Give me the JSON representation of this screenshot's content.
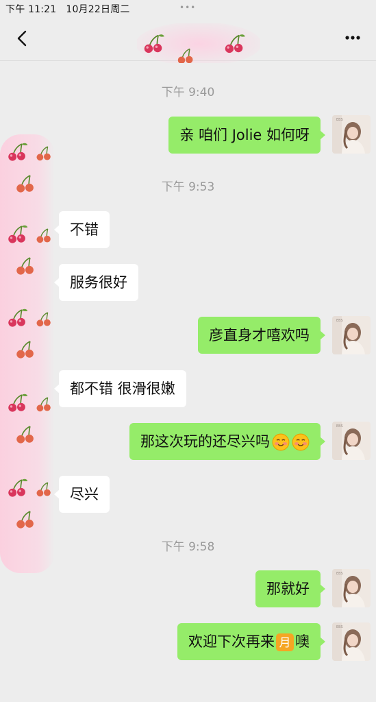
{
  "status": {
    "time": "下午 11:21",
    "date": "10月22日周二",
    "dots": "•••"
  },
  "chat": {
    "timestamps": [
      "下午 9:40",
      "下午 9:53",
      "下午 9:58"
    ],
    "messages": [
      {
        "side": "right",
        "text": "亲 咱们 Jolie 如何呀"
      },
      {
        "side": "left",
        "text": "不错"
      },
      {
        "side": "left",
        "text": "服务很好"
      },
      {
        "side": "right",
        "text": "彦直身才嘻欢吗"
      },
      {
        "side": "left",
        "text": "都不错 很滑很嫩"
      },
      {
        "side": "right",
        "text": "那这次玩的还尽兴吗",
        "emoji": "smiling-face x2"
      },
      {
        "side": "left",
        "text": "尽兴"
      },
      {
        "side": "right",
        "text": "那就好"
      },
      {
        "side": "right",
        "text_before": "欢迎下次再来",
        "emoji": "moon-badge",
        "emoji_text": "月",
        "text_after": "噢"
      }
    ]
  },
  "colors": {
    "background": "#ededed",
    "right_bubble": "#95ec69",
    "left_bubble": "#ffffff",
    "cherry": "#d9365c",
    "timestamp": "#9a9a9a"
  },
  "icons": {
    "back": "chevron-left-icon",
    "more": "more-icon",
    "cherry": "cherry-icon"
  }
}
